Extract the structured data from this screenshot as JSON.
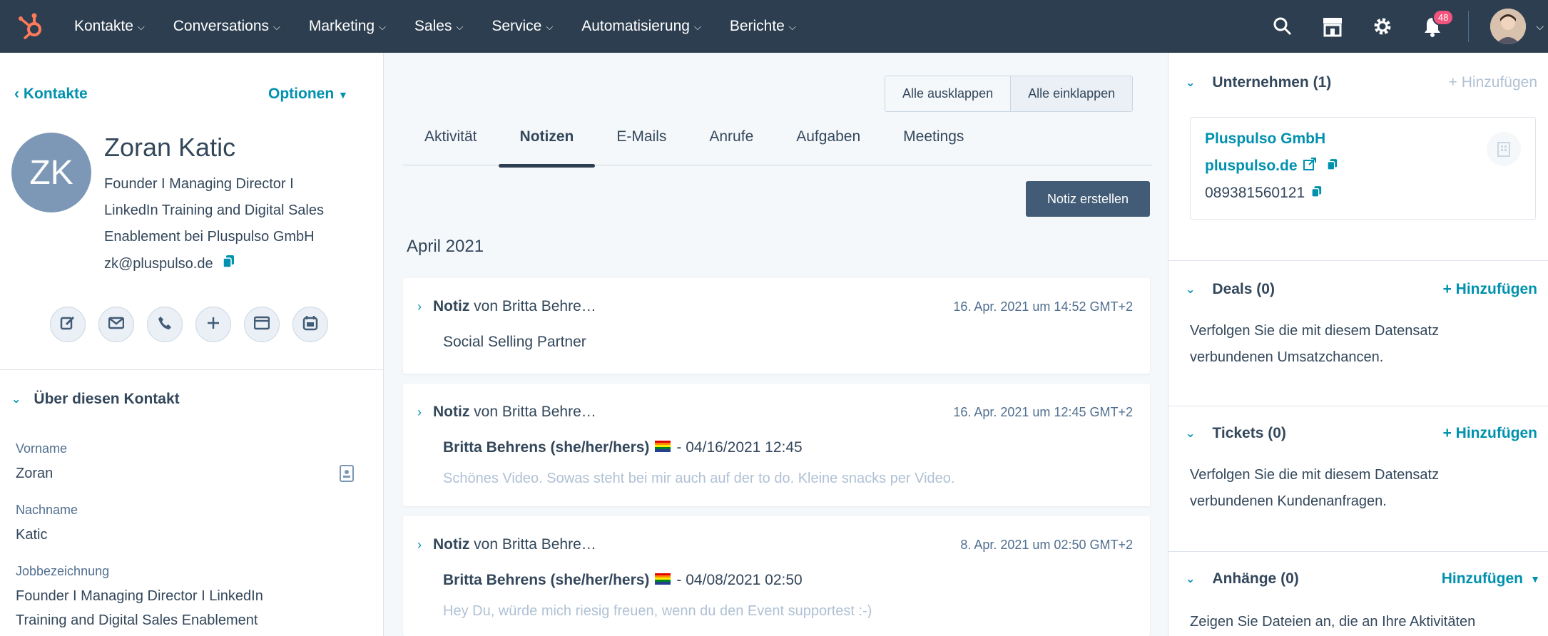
{
  "nav": {
    "items": [
      "Kontakte",
      "Conversations",
      "Marketing",
      "Sales",
      "Service",
      "Automatisierung",
      "Berichte"
    ],
    "notifications_count": "48"
  },
  "contact": {
    "back_label": "Kontakte",
    "options_label": "Optionen",
    "initials": "ZK",
    "name": "Zoran Katic",
    "title_lines": [
      "Founder I Managing Director I",
      "LinkedIn Training and Digital Sales",
      "Enablement bei Pluspulso GmbH"
    ],
    "email": "zk@pluspulso.de"
  },
  "about": {
    "heading": "Über diesen Kontakt",
    "fields": [
      {
        "label": "Vorname",
        "value": "Zoran"
      },
      {
        "label": "Nachname",
        "value": "Katic"
      },
      {
        "label": "Jobbezeichnung",
        "value_lines": [
          "Founder I Managing Director I LinkedIn",
          "Training and Digital Sales Enablement"
        ]
      }
    ]
  },
  "timeline": {
    "expand_all": "Alle ausklappen",
    "collapse_all": "Alle einklappen",
    "tabs": [
      "Aktivität",
      "Notizen",
      "E-Mails",
      "Anrufe",
      "Aufgaben",
      "Meetings"
    ],
    "active_tab": "Notizen",
    "create_note": "Notiz erstellen",
    "month": "April 2021",
    "notes": [
      {
        "type": "Notiz",
        "author": "von Britta Behre…",
        "timestamp": "16. Apr. 2021 um 14:52 GMT+2",
        "body": "Social Selling Partner"
      },
      {
        "type": "Notiz",
        "author": "von Britta Behre…",
        "timestamp": "16. Apr. 2021 um 12:45 GMT+2",
        "sub_author": "Britta Behrens (she/her/hers)",
        "sub_date": "- 04/16/2021 12:45",
        "preview": "Schönes Video. Sowas steht bei mir auch auf der to do. Kleine snacks per Video."
      },
      {
        "type": "Notiz",
        "author": "von Britta Behre…",
        "timestamp": "8. Apr. 2021 um 02:50 GMT+2",
        "sub_author": "Britta Behrens (she/her/hers)",
        "sub_date": "- 04/08/2021 02:50",
        "preview": "Hey Du, würde mich riesig freuen, wenn du den Event supportest :-)"
      }
    ]
  },
  "sidebar": {
    "company": {
      "heading": "Unternehmen (1)",
      "add": "+ Hinzufügen",
      "name": "Pluspulso GmbH",
      "domain": "pluspulso.de",
      "phone": "089381560121"
    },
    "deals": {
      "heading": "Deals (0)",
      "add": "+ Hinzufügen",
      "text_lines": [
        "Verfolgen Sie die mit diesem Datensatz",
        "verbundenen Umsatzchancen."
      ]
    },
    "tickets": {
      "heading": "Tickets (0)",
      "add": "+ Hinzufügen",
      "text_lines": [
        "Verfolgen Sie die mit diesem Datensatz",
        "verbundenen Kundenanfragen."
      ]
    },
    "attachments": {
      "heading": "Anhänge (0)",
      "add": "Hinzufügen",
      "text": "Zeigen Sie Dateien an, die an Ihre Aktivitäten"
    }
  },
  "colors": {
    "nav_bg": "#2d3e50",
    "link": "#0091ae",
    "primary_btn": "#425b76",
    "badge": "#f2547d",
    "avatar": "#7c98b6"
  }
}
